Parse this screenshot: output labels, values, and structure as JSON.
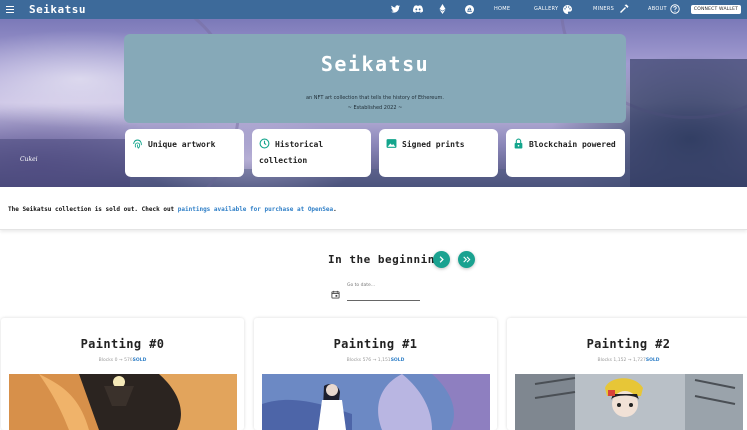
{
  "header": {
    "brand": "Seikatsu",
    "nav": {
      "home": "HOME",
      "gallery": "GALLERY",
      "miners": "MINERS",
      "about": "ABOUT"
    },
    "connect_wallet": "CONNECT WALLET",
    "icons": [
      "twitter-icon",
      "discord-icon",
      "ethereum-icon",
      "opensea-icon",
      "palette-icon",
      "hammer-icon",
      "help-icon"
    ]
  },
  "hero": {
    "title": "Seikatsu",
    "tagline": "an NFT art collection that tells the history of Ethereum.",
    "established": "~ Established 2022 ~",
    "features": [
      {
        "icon": "fingerprint-icon",
        "label": "Unique artwork"
      },
      {
        "icon": "clock-icon",
        "label": "Historical collection"
      },
      {
        "icon": "image-icon",
        "label": "Signed prints"
      },
      {
        "icon": "lock-icon",
        "label": "Blockchain powered"
      }
    ],
    "signature": "Cukei"
  },
  "notice": {
    "text": "The Seikatsu collection is sold out. Check out ",
    "link": "paintings available for purchase at OpenSea",
    "end": "."
  },
  "section": {
    "title": "In the beginning",
    "date_label": "Go to date...",
    "date_value": ""
  },
  "paintings": [
    {
      "title": "Painting #0",
      "blocks": "Blocks 0 → 576",
      "status": "SOLD"
    },
    {
      "title": "Painting #1",
      "blocks": "Blocks 576 → 1,151",
      "status": "SOLD"
    },
    {
      "title": "Painting #2",
      "blocks": "Blocks 1,152 → 1,727",
      "status": "SOLD"
    }
  ],
  "colors": {
    "header": "#3d6a9a",
    "accent": "#1aa290",
    "link": "#2f7fc7",
    "panel": "#86a9b8"
  }
}
